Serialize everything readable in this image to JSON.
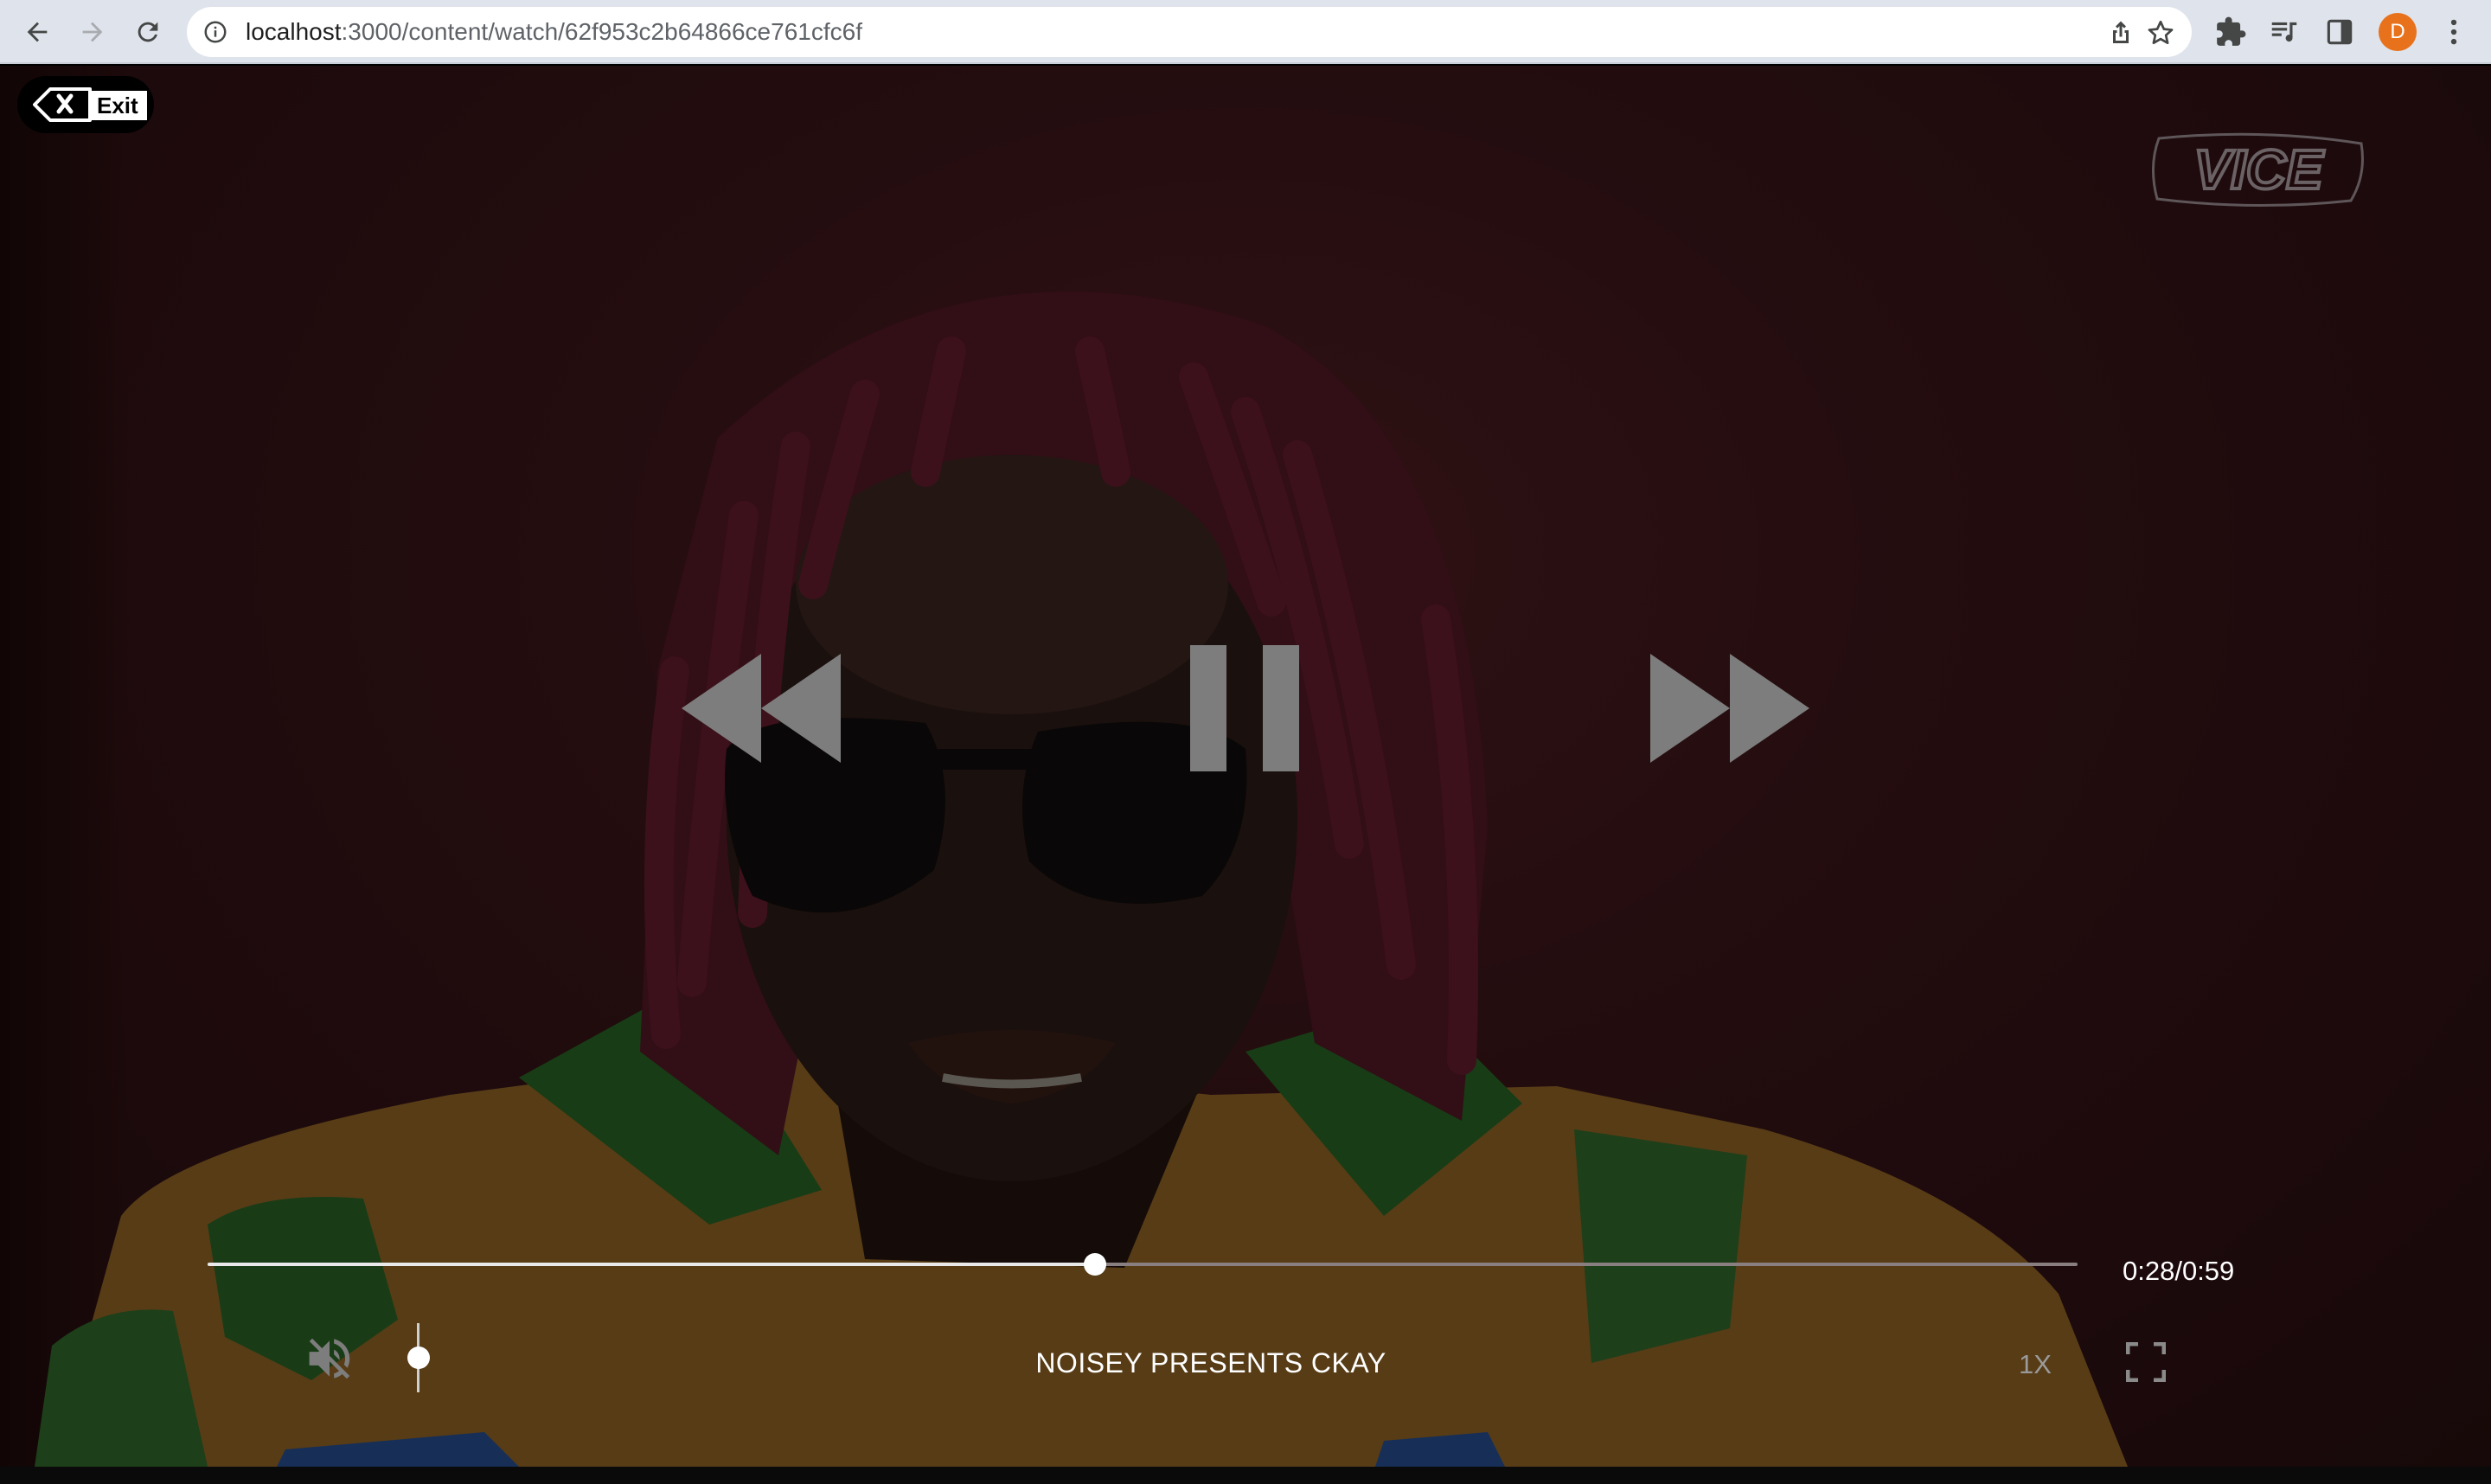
{
  "browser": {
    "url_host": "localhost",
    "url_path": ":3000/content/watch/62f953c2b64866ce761cfc6f",
    "profile_initial": "D",
    "profile_color": "#e8711c"
  },
  "player": {
    "exit_label": "Exit",
    "channel_logo": "VICE",
    "time_current": "0:28",
    "time_total": "0:59",
    "time_readout": "0:28/0:59",
    "progress_fraction": 0.4746,
    "volume_fraction": 0.0,
    "muted": true,
    "title": "NOISEY PRESENTS CKAY",
    "speed_label": "1X",
    "state": "playing"
  },
  "icons": {
    "back": "arrow-left-icon",
    "forward": "arrow-right-icon",
    "reload": "reload-icon",
    "info": "info-icon",
    "share": "share-icon",
    "bookmark": "star-icon",
    "extensions": "puzzle-icon",
    "media": "media-queue-icon",
    "sidepanel": "side-panel-icon",
    "menu": "kebab-menu-icon",
    "exit": "backspace-x-icon",
    "rewind": "rewind-icon",
    "pause": "pause-icon",
    "fast_forward": "fast-forward-icon",
    "mute": "volume-muted-icon",
    "fullscreen": "fullscreen-icon"
  },
  "colors": {
    "chrome_bg": "#dfe3eb",
    "controls_gray": "#7d7d7d",
    "progress_played": "#e9e9e9",
    "progress_remaining": "#8a7f80"
  }
}
